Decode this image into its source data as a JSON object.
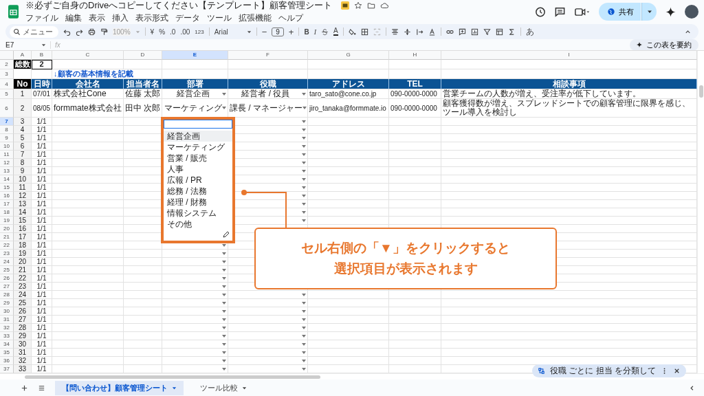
{
  "document": {
    "title": "※必ずご自身のDriveへコピーしてください【テンプレート】顧客管理シート"
  },
  "menu": [
    "ファイル",
    "編集",
    "表示",
    "挿入",
    "表示形式",
    "データ",
    "ツール",
    "拡張機能",
    "ヘルプ"
  ],
  "share_button": {
    "label": "共有"
  },
  "toolbar": {
    "search": "メニュー",
    "zoom": "100%",
    "currency": "¥",
    "percent": "%",
    "decrease_decimal": ".0",
    "increase_decimal": ".00",
    "number_format": "123",
    "font": "Arial",
    "font_size": "9",
    "decrease_font_size": "−",
    "increase_font_size": "+",
    "bold": "B",
    "italic": "I",
    "text_color": "A",
    "input_mode": "あ"
  },
  "name_box": "E7",
  "formula_label": "fx",
  "summarize_button": "この表を要約",
  "columns": [
    {
      "label": "A",
      "selected": false
    },
    {
      "label": "B",
      "selected": false
    },
    {
      "label": "C",
      "selected": false
    },
    {
      "label": "D",
      "selected": false
    },
    {
      "label": "E",
      "selected": true
    },
    {
      "label": "F",
      "selected": false
    },
    {
      "label": "G",
      "selected": false
    },
    {
      "label": "H",
      "selected": false
    },
    {
      "label": "I",
      "selected": false
    }
  ],
  "total": {
    "row": "2",
    "label": "総数",
    "value": "2"
  },
  "section_note": {
    "row": "3",
    "text": "↓顧客の基本情報を記載"
  },
  "header_row": {
    "row": "4",
    "labels": [
      "No",
      "日時",
      "会社名",
      "担当者名",
      "部署",
      "役職",
      "アドレス",
      "TEL",
      "相談事項"
    ]
  },
  "rows": [
    {
      "row": "5",
      "no": "1",
      "date": "07/01",
      "company": "株式会社Cone",
      "person": "佐藤 太郎",
      "department": "経営企画",
      "position": "経営者 / 役員",
      "email": "taro_sato@cone.co.jp",
      "tel": "090-0000-0000",
      "notes": "営業チームの人数が増え、受注率が低下しています。",
      "selected": false
    },
    {
      "row": "6",
      "no": "2",
      "date": "08/05",
      "company": "formmate株式会社",
      "person": "田中 次郎",
      "department": "マーケティング",
      "position": "課長 / マネージャー",
      "email": "jiro_tanaka@formmate.io",
      "tel": "090-0000-0000",
      "notes": "顧客獲得数が増え、スプレッドシートでの顧客管理に限界を感じ、ツール導入を検討し",
      "selected": false
    },
    {
      "row": "7",
      "no": "3",
      "date": "1/1",
      "selected": true
    },
    {
      "row": "8",
      "no": "4",
      "date": "1/1",
      "selected": false
    },
    {
      "row": "9",
      "no": "5",
      "date": "1/1",
      "selected": false
    },
    {
      "row": "10",
      "no": "6",
      "date": "1/1",
      "selected": false
    },
    {
      "row": "11",
      "no": "7",
      "date": "1/1",
      "selected": false
    },
    {
      "row": "12",
      "no": "8",
      "date": "1/1",
      "selected": false
    },
    {
      "row": "13",
      "no": "9",
      "date": "1/1",
      "selected": false
    },
    {
      "row": "14",
      "no": "10",
      "date": "1/1",
      "selected": false
    },
    {
      "row": "15",
      "no": "11",
      "date": "1/1",
      "selected": false
    },
    {
      "row": "16",
      "no": "12",
      "date": "1/1",
      "selected": false
    },
    {
      "row": "17",
      "no": "13",
      "date": "1/1",
      "selected": false
    },
    {
      "row": "18",
      "no": "14",
      "date": "1/1",
      "selected": false
    },
    {
      "row": "19",
      "no": "15",
      "date": "1/1",
      "selected": false
    },
    {
      "row": "20",
      "no": "16",
      "date": "1/1",
      "selected": false
    },
    {
      "row": "21",
      "no": "17",
      "date": "1/1",
      "selected": false
    },
    {
      "row": "22",
      "no": "18",
      "date": "1/1",
      "selected": false
    },
    {
      "row": "23",
      "no": "19",
      "date": "1/1",
      "selected": false
    },
    {
      "row": "24",
      "no": "20",
      "date": "1/1",
      "selected": false
    },
    {
      "row": "25",
      "no": "21",
      "date": "1/1",
      "selected": false
    },
    {
      "row": "26",
      "no": "22",
      "date": "1/1",
      "selected": false
    },
    {
      "row": "27",
      "no": "23",
      "date": "1/1",
      "selected": false
    },
    {
      "row": "28",
      "no": "24",
      "date": "1/1",
      "selected": false
    },
    {
      "row": "29",
      "no": "25",
      "date": "1/1",
      "selected": false
    },
    {
      "row": "30",
      "no": "26",
      "date": "1/1",
      "selected": false
    },
    {
      "row": "31",
      "no": "27",
      "date": "1/1",
      "selected": false
    },
    {
      "row": "32",
      "no": "28",
      "date": "1/1",
      "selected": false
    },
    {
      "row": "33",
      "no": "29",
      "date": "1/1",
      "selected": false
    },
    {
      "row": "34",
      "no": "30",
      "date": "1/1",
      "selected": false
    },
    {
      "row": "35",
      "no": "31",
      "date": "1/1",
      "selected": false
    },
    {
      "row": "36",
      "no": "32",
      "date": "1/1",
      "selected": false
    },
    {
      "row": "37",
      "no": "33",
      "date": "1/1",
      "selected": false
    }
  ],
  "dropdown": {
    "options": [
      {
        "label": "経営企画",
        "selected": true
      },
      {
        "label": "マーケティング",
        "selected": false
      },
      {
        "label": "営業 / 販売",
        "selected": false
      },
      {
        "label": "人事",
        "selected": false
      },
      {
        "label": "広報 / PR",
        "selected": false
      },
      {
        "label": "総務 / 法務",
        "selected": false
      },
      {
        "label": "経理 / 財務",
        "selected": false
      },
      {
        "label": "情報システム",
        "selected": false
      },
      {
        "label": "その他",
        "selected": false
      }
    ]
  },
  "callout": {
    "lines": [
      "セル右側の「▼」をクリックすると",
      "選択項目が表示されます"
    ]
  },
  "sheet_tabs": [
    {
      "label": "【問い合わせ】顧客管理シート",
      "selected": true
    },
    {
      "label": "ツール比較",
      "selected": false
    }
  ],
  "suggestion": {
    "text": "役職 ごとに 担当 を分類して"
  }
}
